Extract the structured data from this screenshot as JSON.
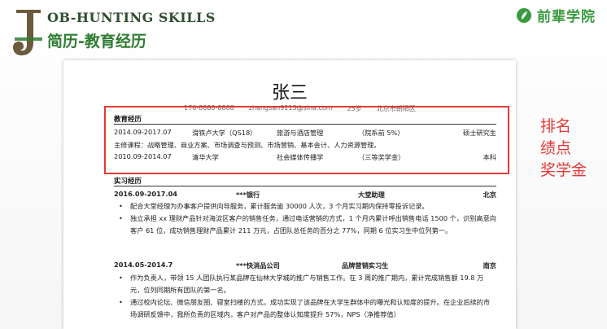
{
  "header": {
    "logo_letter": "J",
    "title_en": "OB-HUNTING SKILLS",
    "title_zh": "简历-教育经历",
    "brand_name": "前辈学院",
    "brand_icon": "leaf-logo-icon",
    "accent_color": "#2e7d32"
  },
  "resume": {
    "name": "张三",
    "contact": [
      "176-8888-8888",
      "zhangsan9213@sina.com",
      "25岁",
      "北京市朝阳区"
    ],
    "education": {
      "title": "教育经历",
      "rows": [
        {
          "date": "2014.09-2017.07",
          "school": "滑铁卢大学（QS18）",
          "major": "旅游与酒店管理",
          "rank": "（院系前 5%）",
          "degree": "硕士研究生"
        },
        {
          "courses": "主修课程：战略管理、商业方案、市场调查与预测、市场营销、基本会计、人力资源管理。"
        },
        {
          "date": "2010.09-2014.07",
          "school": "清华大学",
          "major": "社会媒体传播学",
          "rank": "（三等奖学金）",
          "degree": "本科"
        }
      ]
    },
    "experience": {
      "title": "实习经历",
      "jobs": [
        {
          "date": "2016.09-2017.04",
          "company": "***银行",
          "role": "大堂助理",
          "city": "北京",
          "bullets": [
            "配合大堂经理为办事客户提供向导服务，累计服务逾 30000 人次，3 个月实习期内保持零投诉记录。",
            "独立承担 xx 理财产品针对海淀区客户的销售任务，通过电话营销的方式，1 个月内累计呼出销售电话 1500 个，识别高意向客户 61 位，成功销售理财产品累计 211 万元，占团队总任务的百分之 77%，同期 6 位实习生中位列第一。"
          ]
        },
        {
          "date": "2014.05-2014.7",
          "company": "***快消品公司",
          "role": "品牌营销实习生",
          "city": "南京",
          "bullets": [
            "作为负责人，带领 15 人团队执行某品牌在仙林大学城的推广与销售工作。在 3 周的推广期内，累计完成销售额 19.8 万元，位列同期所有团队的第一名。",
            "通过校内论坛、微信朋友圈、寝室扫楼的方式，成功实现了该品牌在大学生群体中的曝光和认知度的提升。在企业后续的市场调研反馈中，我所负责的区域内，客户对产品的整体认知度提升 57%，NPS（净推荐值）"
          ]
        }
      ]
    }
  },
  "annotation": {
    "box_color": "#e53935",
    "lines": [
      "排名",
      "绩点",
      "奖学金"
    ]
  }
}
